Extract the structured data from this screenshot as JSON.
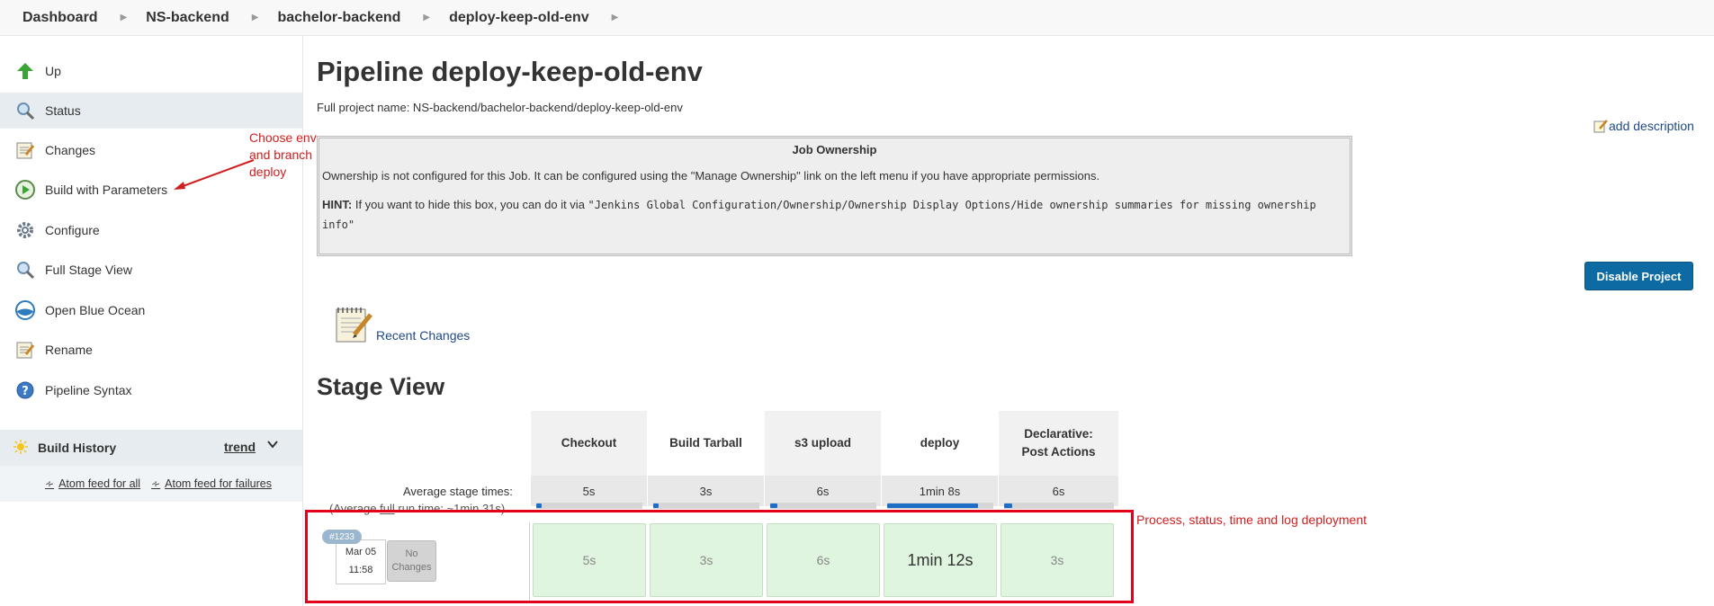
{
  "breadcrumb": [
    "Dashboard",
    "NS-backend",
    "bachelor-backend",
    "deploy-keep-old-env"
  ],
  "sidebar": {
    "items": [
      {
        "label": "Up",
        "icon": "up-arrow-icon"
      },
      {
        "label": "Status",
        "icon": "magnifier-icon"
      },
      {
        "label": "Changes",
        "icon": "notepad-icon"
      },
      {
        "label": "Build with Parameters",
        "icon": "clock-play-icon"
      },
      {
        "label": "Configure",
        "icon": "gear-icon"
      },
      {
        "label": "Full Stage View",
        "icon": "magnifier-icon"
      },
      {
        "label": "Open Blue Ocean",
        "icon": "blue-ocean-icon"
      },
      {
        "label": "Rename",
        "icon": "notepad-icon"
      },
      {
        "label": "Pipeline Syntax",
        "icon": "help-icon"
      }
    ],
    "active_index": 1,
    "annotation": "Choose env\nand branch\ndeploy",
    "build_history": {
      "title": "Build History",
      "trend": "trend",
      "feeds": [
        "Atom feed for all",
        "Atom feed for failures"
      ]
    }
  },
  "main": {
    "title": "Pipeline deploy-keep-old-env",
    "full_name": "Full project name: NS-backend/bachelor-backend/deploy-keep-old-env",
    "add_description": "add description",
    "ownership": {
      "title": "Job Ownership",
      "text": "Ownership is not configured for this Job. It can be configured using the \"Manage Ownership\" link on the left menu if you have appropriate permissions.",
      "hint_label": "HINT:",
      "hint_text": " If you want to hide this box, you can do it via ",
      "hint_code": "\"Jenkins Global Configuration/Ownership/Ownership Display Options/Hide ownership summaries for missing ownership info\""
    },
    "disable_button": "Disable Project",
    "recent_changes": "Recent Changes",
    "stage_view": {
      "title": "Stage View",
      "stages": [
        "Checkout",
        "Build Tarball",
        "s3 upload",
        "deploy",
        "Declarative: Post Actions"
      ],
      "avg_label": "Average stage times:",
      "avg_full_prefix": "(Average ",
      "avg_full_word": "full",
      "avg_full_suffix": " run time: ~1min 31s)",
      "avg_times": [
        "5s",
        "3s",
        "6s",
        "1min 8s",
        "6s"
      ],
      "avg_fractions": [
        0.05,
        0.03,
        0.07,
        0.86,
        0.07
      ],
      "run": {
        "number": "#1233",
        "date": "Mar 05",
        "time": "11:58",
        "changes": "No Changes",
        "times": [
          "5s",
          "3s",
          "6s",
          "1min 12s",
          "3s"
        ],
        "status_color": "#dff5df"
      }
    },
    "annotation": "Process, status, time and log deployment"
  },
  "colors": {
    "accent": "#0e6aa3",
    "annotation": "#d01e1e",
    "link": "#204a87"
  }
}
